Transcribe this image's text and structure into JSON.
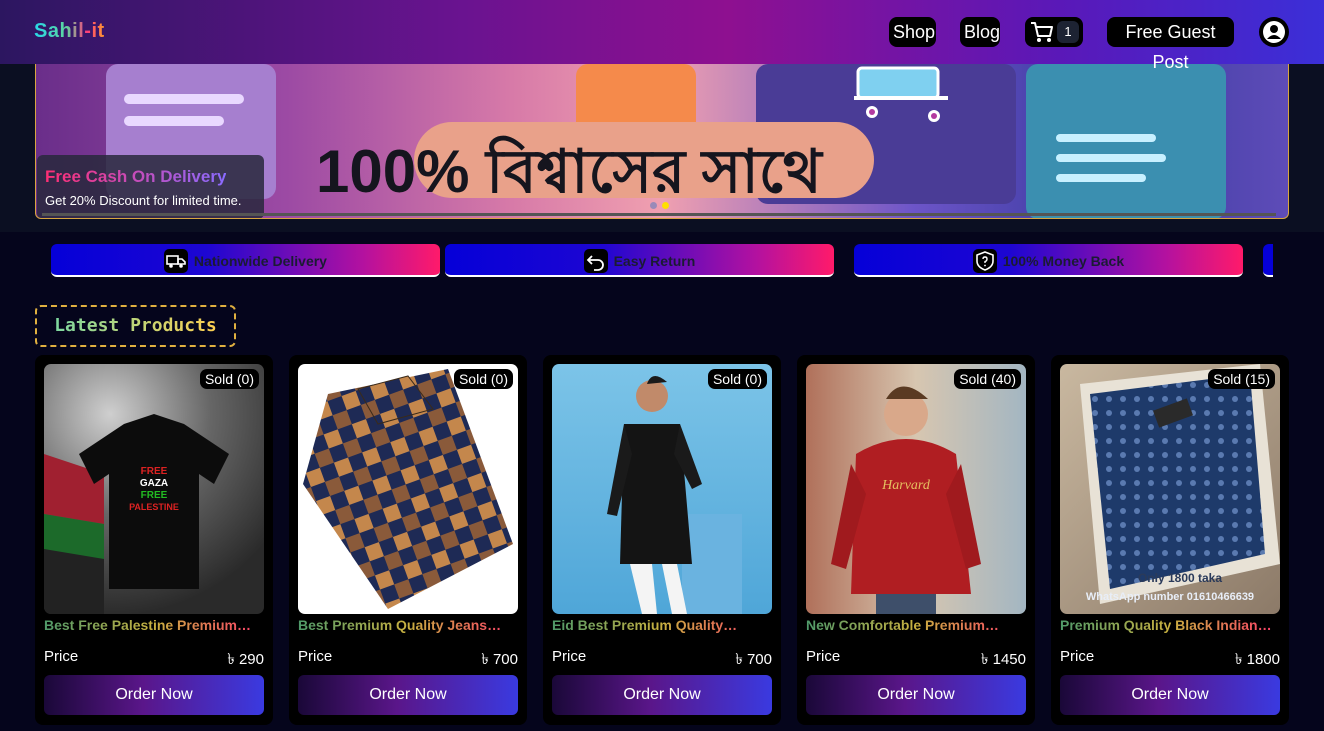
{
  "header": {
    "logo": "Sahil-it",
    "nav": {
      "shop": "Shop",
      "blog": "Blog",
      "cart_count": "1",
      "guest_post": "Free Guest Post"
    }
  },
  "hero": {
    "headline": "100% বিশ্বাসের সাথে",
    "promo_title": "Free Cash On Delivery",
    "promo_subtitle": "Get 20% Discount for limited time."
  },
  "features": [
    {
      "label": "Nationwide Delivery",
      "icon": "truck-icon"
    },
    {
      "label": "Easy Return",
      "icon": "return-icon"
    },
    {
      "label": "100% Money Back",
      "icon": "shield-icon"
    }
  ],
  "section": {
    "title": "Latest Products"
  },
  "products": [
    {
      "sold": "Sold (0)",
      "title": "Best Free Palestine Premium…",
      "price_label": "Price",
      "price": "৳ 290",
      "button": "Order Now"
    },
    {
      "sold": "Sold (0)",
      "title": "Best Premium Quality Jeans…",
      "price_label": "Price",
      "price": "৳ 700",
      "button": "Order Now"
    },
    {
      "sold": "Sold (0)",
      "title": "Eid Best Premium Quality…",
      "price_label": "Price",
      "price": "৳ 700",
      "button": "Order Now"
    },
    {
      "sold": "Sold (40)",
      "title": "New Comfortable Premium…",
      "price_label": "Price",
      "price": "৳ 1450",
      "button": "Order Now"
    },
    {
      "sold": "Sold (15)",
      "title": "Premium Quality Black Indian…",
      "price_label": "Price",
      "price": "৳ 1800",
      "button": "Order Now"
    }
  ],
  "product_image_text": {
    "tshirt_print": "FREE GAZA FREE PALESTINE",
    "hoodie_print": "Harvard",
    "shirt_offer": "Only 1800 taka",
    "shirt_phone": "WhatsApp number 01610466639"
  },
  "colors": {
    "accent_gold": "#e0b040",
    "button_gradient_start": "#1a0838",
    "button_gradient_end": "#3a3ae0"
  }
}
